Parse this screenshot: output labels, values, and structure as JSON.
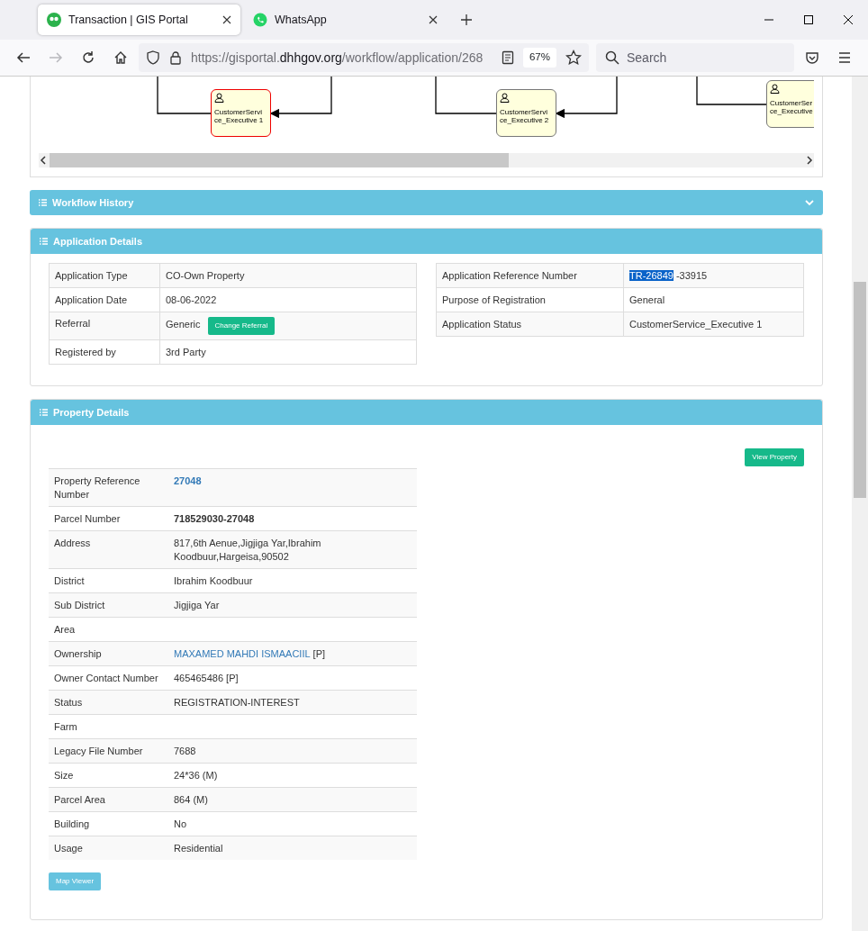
{
  "browser": {
    "tabs": [
      {
        "title": "Transaction | GIS Portal",
        "selected": true,
        "kind": "gis"
      },
      {
        "title": "WhatsApp",
        "selected": false,
        "kind": "chat"
      }
    ],
    "nav_buttons": [
      {
        "kind": "back",
        "disabled": false
      },
      {
        "kind": "forward",
        "disabled": true
      },
      {
        "kind": "reload",
        "disabled": false
      },
      {
        "kind": "home",
        "disabled": false
      }
    ],
    "url": {
      "prefix": "https://gisportal.",
      "domain": "dhhgov.org",
      "path": "/workflow/application/268"
    },
    "zoom": "67%",
    "search": {
      "placeholder": "Search"
    }
  },
  "workflow_diagram": {
    "nodes": [
      {
        "lines": [
          "CustomerServi",
          "ce_Executive 1"
        ],
        "current": true
      },
      {
        "lines": [
          "CustomerServi",
          "ce_Executive 2"
        ],
        "current": false
      },
      {
        "lines": [
          "CustomerSer",
          "ce_Executive"
        ],
        "current": false
      }
    ]
  },
  "workflow_history": {
    "title": "Workflow History",
    "expanded": false
  },
  "application_details": {
    "title": "Application Details",
    "left_rows": [
      {
        "label": "Application Type",
        "value": "CO-Own Property"
      },
      {
        "label": "Application Date",
        "value": "08-06-2022"
      },
      {
        "label": "Referral",
        "value": "Generic",
        "button": "Change Referral"
      },
      {
        "label": "Registered by",
        "value": "3rd Party"
      }
    ],
    "right_rows": [
      {
        "label": "Application Reference Number",
        "parts": [
          {
            "text": "TR-26849",
            "selected": true
          },
          {
            "text": "-33915",
            "selected": false
          }
        ]
      },
      {
        "label": "Purpose of Registration",
        "parts": [
          {
            "text": "General",
            "selected": false
          }
        ]
      },
      {
        "label": "Application Status",
        "parts": [
          {
            "text": "CustomerService_Executive 1",
            "selected": false
          }
        ]
      }
    ]
  },
  "property_details": {
    "title": "Property Details",
    "view_button": "View Property",
    "rows": [
      {
        "label": "Property Reference Number",
        "value": "27048",
        "kind": "link-bold"
      },
      {
        "label": "Parcel Number",
        "value": "718529030-27048",
        "kind": "bold"
      },
      {
        "label": "Address",
        "value": "817,6th Aenue,Jigjiga Yar,Ibrahim Koodbuur,Hargeisa,90502",
        "kind": "text"
      },
      {
        "label": "District",
        "value": "Ibrahim Koodbuur",
        "kind": "text"
      },
      {
        "label": "Sub District",
        "value": "Jigjiga Yar",
        "kind": "text"
      },
      {
        "label": "Area"
      },
      {
        "label": "Ownership",
        "value": "MAXAMED MAHDI ISMAACIIL",
        "suffix": "[P]",
        "kind": "link"
      },
      {
        "label": "Owner Contact Number",
        "value": "465465486 [P]",
        "kind": "text"
      },
      {
        "label": "Status",
        "value": "REGISTRATION-INTEREST",
        "kind": "text"
      },
      {
        "label": "Farm"
      },
      {
        "label": "Legacy File Number",
        "value": "7688",
        "kind": "text"
      },
      {
        "label": "Size",
        "value": "24*36 (M)",
        "kind": "text"
      },
      {
        "label": "Parcel Area",
        "value": "864 (M)",
        "kind": "text"
      },
      {
        "label": "Building",
        "value": "No",
        "kind": "text"
      },
      {
        "label": "Usage",
        "value": "Residential",
        "kind": "text"
      }
    ],
    "map_button": "Map Viewer"
  }
}
